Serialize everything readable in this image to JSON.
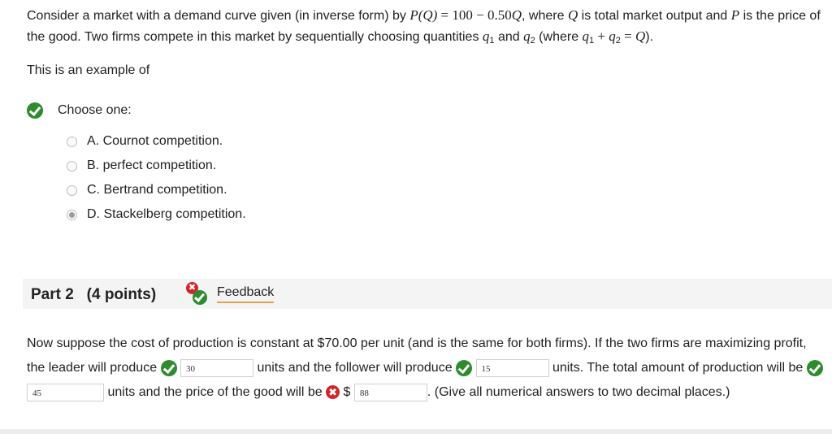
{
  "question": {
    "t1": "Consider a market with a demand curve given (in inverse form) by ",
    "pq": "P(Q)",
    "eq": " = 100 − 0.50",
    "qv": "Q",
    "t2": ", where ",
    "q2": "Q",
    "t3": " is total market output and ",
    "p2": "P",
    "t4": " is the price of the good. Two firms compete in this market by sequentially choosing quantities ",
    "q_letter": "q",
    "sub1": "1",
    "t5": " and ",
    "sub2": "2",
    "t6": " (where ",
    "plus": " + ",
    "eq2": " = ",
    "t7": "Q",
    "t8": ")."
  },
  "prompt": "This is an example of",
  "choose_label": "Choose one:",
  "options": [
    {
      "label": "A. Cournot competition.",
      "selected": false
    },
    {
      "label": "B. perfect competition.",
      "selected": false
    },
    {
      "label": "C. Bertrand competition.",
      "selected": false
    },
    {
      "label": "D. Stackelberg competition.",
      "selected": true
    }
  ],
  "part2": {
    "title": "Part 2",
    "points": "(4 points)",
    "feedback_label": "Feedback",
    "err_symbol": "✖",
    "text1": "Now suppose the cost of production is constant at $70.00 per unit (and is the same for both firms). If the two firms are maximizing profit, the leader will produce",
    "leader_value": "30",
    "text2": "units and the follower will produce",
    "follower_value": "15",
    "text3": "units. The total amount of production will be",
    "total_value": "45",
    "text4": "units and the price of the good will be",
    "currency": "$",
    "price_value": "88",
    "text5": ". (Give all numerical answers to two decimal places.)"
  },
  "colors": {
    "correct": "#2e8b2e",
    "incorrect": "#d0262c",
    "feedback_underline": "#e5a14a"
  }
}
